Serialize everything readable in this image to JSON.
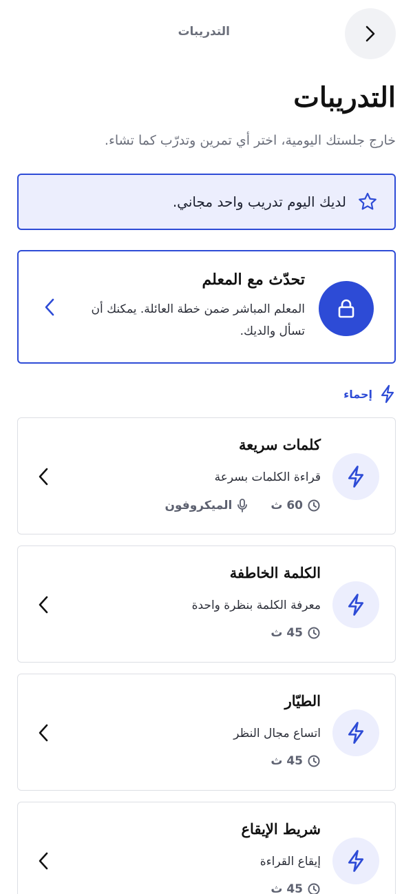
{
  "header": {
    "title": "التدريبات"
  },
  "page": {
    "title": "التدريبات",
    "subtitle": "خارج جلستك اليومية، اختر أي تمرين وتدرّب كما تشاء."
  },
  "banner": {
    "text": "لديك اليوم تدريب واحد مجاني."
  },
  "teacher": {
    "title": "تحدّث مع المعلم",
    "description": "المعلم المباشر ضمن خطة العائلة. يمكنك أن تسأل والديك."
  },
  "section": {
    "label": "إحماء"
  },
  "drills": [
    {
      "title": "كلمات سريعة",
      "description": "قراءة الكلمات بسرعة",
      "duration": "60 ث",
      "requirement": "الميكروفون"
    },
    {
      "title": "الكلمة الخاطفة",
      "description": "معرفة الكلمة بنظرة واحدة",
      "duration": "45 ث"
    },
    {
      "title": "الطيّار",
      "description": "اتساع مجال النظر",
      "duration": "45 ث"
    },
    {
      "title": "شريط الإيقاع",
      "description": "إيقاع القراءة",
      "duration": "45 ث"
    }
  ],
  "icons": {
    "back": "chevron-right-icon",
    "banner": "star-icon",
    "teacher": "lock-icon",
    "section": "lightning-icon",
    "drill": "lightning-icon",
    "duration": "clock-icon",
    "requirement": "microphone-icon",
    "open": "chevron-left-icon"
  },
  "colors": {
    "accent": "#2d4bd6",
    "accent_soft": "#eceefd",
    "muted_text": "#6b6f7b",
    "border": "#dcdee4"
  }
}
